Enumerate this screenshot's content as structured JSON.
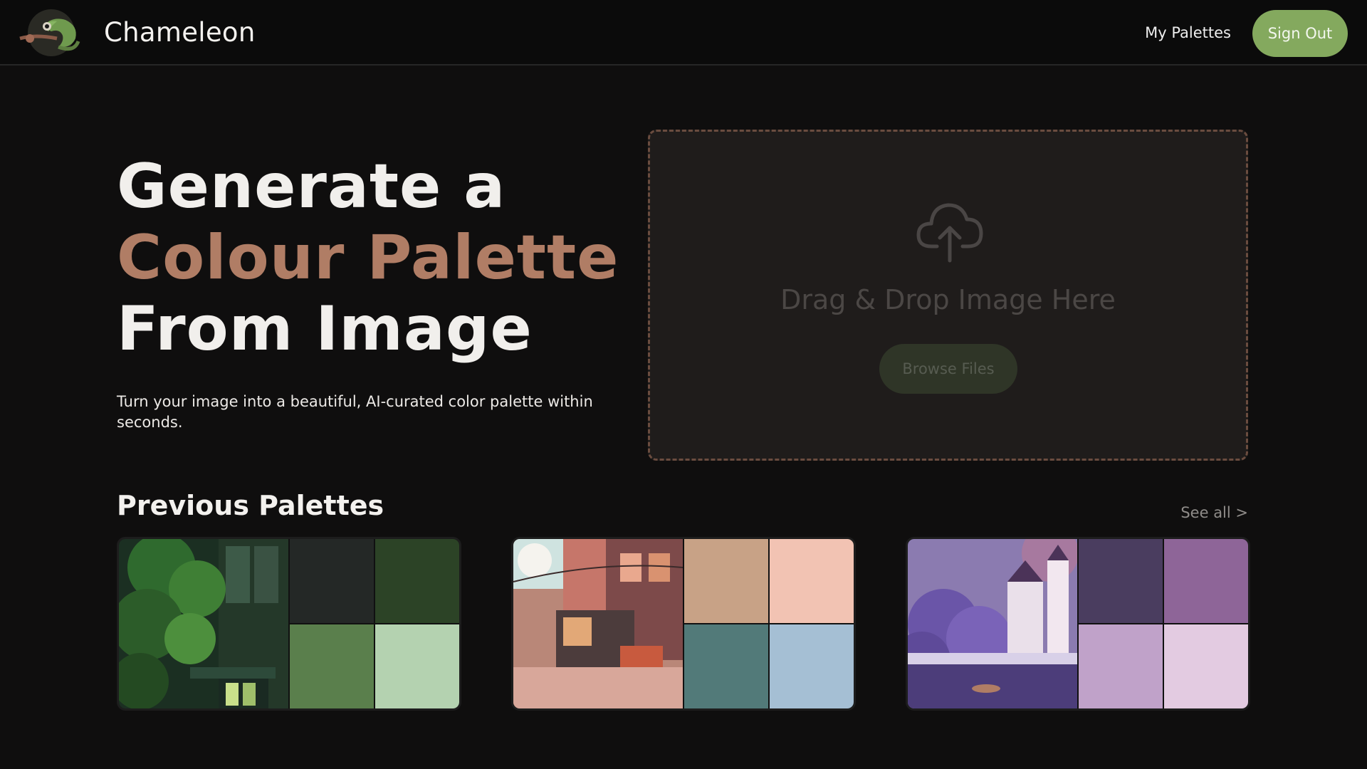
{
  "header": {
    "brand": "Chameleon",
    "nav_my_palettes": "My Palettes",
    "sign_out": "Sign Out",
    "logo_icon": "chameleon-logo-icon"
  },
  "hero": {
    "line1": "Generate a",
    "line2": "Colour Palette",
    "line3": "From Image",
    "subtitle": "Turn your image into a beautiful, AI-curated color palette within seconds.",
    "accent_color": "#b07d65"
  },
  "dropzone": {
    "icon": "cloud-upload-icon",
    "text": "Drag & Drop Image Here",
    "browse_label": "Browse Files"
  },
  "previous": {
    "title": "Previous Palettes",
    "see_all": "See all >",
    "cards": [
      {
        "image": "forest-window-image",
        "colors": [
          "#242826",
          "#2c4326",
          "#5a7f4c",
          "#b4d2b0"
        ]
      },
      {
        "image": "city-street-image",
        "colors": [
          "#c8a286",
          "#f2c3b3",
          "#527a79",
          "#a5bfd4"
        ]
      },
      {
        "image": "purple-castle-image",
        "colors": [
          "#4a3d5f",
          "#8e6598",
          "#c0a2c9",
          "#e3cbe1"
        ]
      }
    ]
  },
  "colors": {
    "background": "#0f0e0e",
    "brand_green": "#84a95e",
    "dropzone_border": "#6a4c3f"
  }
}
